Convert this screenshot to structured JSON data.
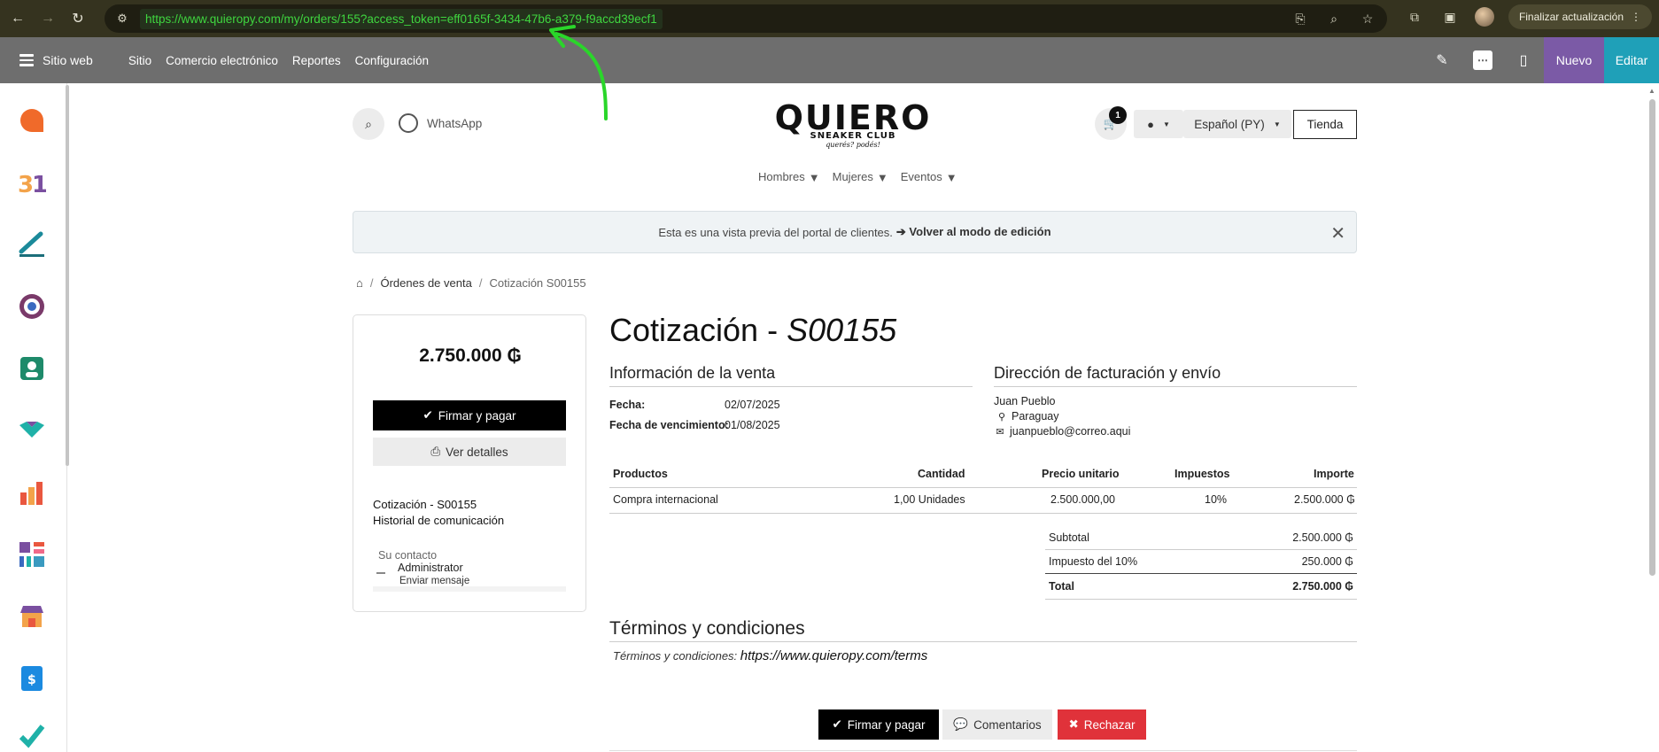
{
  "browser": {
    "url": "https://www.quieropy.com/my/orders/155?access_token=eff0165f-3434-47b6-a379-f9accd39ecf1",
    "update_label": "Finalizar actualización"
  },
  "odoo_bar": {
    "brand": "Sitio web",
    "menu": [
      "Sitio",
      "Comercio electrónico",
      "Reportes",
      "Configuración"
    ],
    "nuevo": "Nuevo",
    "editar": "Editar"
  },
  "site_header": {
    "whatsapp": "WhatsApp",
    "logo_main": "QUIERO",
    "logo_sub": "SNEAKER CLUB",
    "logo_tag": "querés? podés!",
    "cart_count": "1",
    "language": "Español (PY)",
    "store": "Tienda",
    "nav": [
      "Hombres",
      "Mujeres",
      "Eventos"
    ]
  },
  "banner": {
    "text": "Esta es una vista previa del portal de clientes.",
    "link": "Volver al modo de edición"
  },
  "breadcrumb": {
    "orders": "Órdenes de venta",
    "current": "Cotización S00155"
  },
  "sidebar_card": {
    "amount": "2.750.000 ₲",
    "sign_pay": "Firmar y pagar",
    "details": "Ver detalles",
    "link_quote": "Cotización - S00155",
    "link_history": "Historial de comunicación",
    "contact_heading": "Su contacto",
    "contact_name": "Administrator",
    "contact_msg": "Enviar mensaje"
  },
  "document": {
    "title_prefix": "Cotización - ",
    "title_number": "S00155",
    "sale_info_heading": "Información de la venta",
    "date_label": "Fecha:",
    "date_value": "02/07/2025",
    "due_label": "Fecha de vencimiento:",
    "due_value": "01/08/2025",
    "address_heading": "Dirección de facturación y envío",
    "customer": "Juan Pueblo",
    "country": "Paraguay",
    "email": "juanpueblo@correo.aqui"
  },
  "table": {
    "headers": [
      "Productos",
      "Cantidad",
      "Precio unitario",
      "Impuestos",
      "Importe"
    ],
    "rows": [
      [
        "Compra internacional",
        "1,00 Unidades",
        "2.500.000,00",
        "10%",
        "2.500.000 ₲"
      ]
    ]
  },
  "totals": {
    "subtotal_label": "Subtotal",
    "subtotal_value": "2.500.000 ₲",
    "tax_label": "Impuesto del 10%",
    "tax_value": "250.000 ₲",
    "total_label": "Total",
    "total_value": "2.750.000 ₲"
  },
  "terms": {
    "heading": "Términos y condiciones",
    "label": "Términos y condiciones:",
    "url": "https://www.quieropy.com/terms"
  },
  "actions": {
    "sign_pay": "Firmar y pagar",
    "comments": "Comentarios",
    "reject": "Rechazar"
  }
}
